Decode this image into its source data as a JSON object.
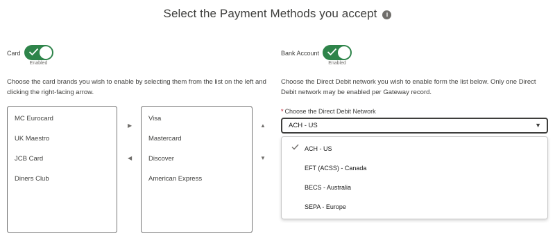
{
  "header": {
    "title": "Select the Payment Methods you accept",
    "info_icon": "i"
  },
  "card_section": {
    "toggle_label": "Card",
    "toggle_status": "Enabled",
    "toggle_on": true,
    "description": "Choose the card brands you wish to enable by selecting them from the list on the left and clicking the right-facing arrow.",
    "available_items": [
      "MC Eurocard",
      "UK Maestro",
      "JCB Card",
      "Diners Club"
    ],
    "selected_items": [
      "Visa",
      "Mastercard",
      "Discover",
      "American Express"
    ],
    "icons": {
      "move_right": "▶",
      "move_left": "◀",
      "move_up": "▲",
      "move_down": "▼"
    }
  },
  "bank_section": {
    "toggle_label": "Bank Account",
    "toggle_status": "Enabled",
    "toggle_on": true,
    "description": "Choose the Direct Debit network you wish to enable form the list below. Only one Direct Debit network may be enabled per Gateway record.",
    "field_label": "Choose the Direct Debit Network",
    "required_marker": "*",
    "selected_value": "ACH - US",
    "caret_icon": "▼",
    "options": [
      "ACH - US",
      "EFT (ACSS) - Canada",
      "BECS - Australia",
      "SEPA - Europe"
    ],
    "selected_option_index": 0
  },
  "colors": {
    "toggle_on": "#2e844a",
    "border": "#747474",
    "text": "#3e3e3c",
    "required": "#ba0517"
  }
}
